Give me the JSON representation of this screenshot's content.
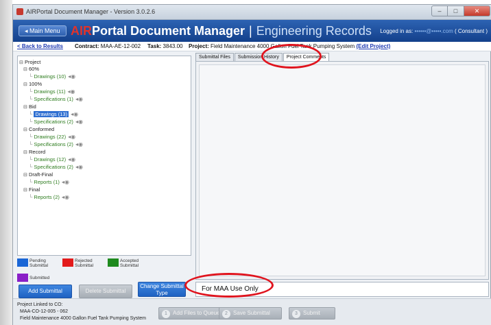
{
  "window": {
    "title": "AIRPortal Document Manager - Version 3.0.2.6",
    "minimize": "–",
    "maximize": "□",
    "close": "✕"
  },
  "header": {
    "main_menu": "◂ Main Menu",
    "brand_air": "AIR",
    "brand_rest": "Portal Document Manager",
    "brand_divider": "|",
    "brand_sub": "Engineering Records",
    "logged_in_label": "Logged in as:",
    "logged_in_user": "••••••@•••••.com",
    "logged_in_role": "( Consultant )"
  },
  "infobar": {
    "back": "< Back to Results",
    "contract_label": "Contract:",
    "contract_value": "MAA-AE-12-002",
    "task_label": "Task:",
    "task_value": "3843.00",
    "project_label": "Project:",
    "project_value": "Field Maintenance 4000 Gallon Fuel Tank Pumping System",
    "edit": "(Edit Project)"
  },
  "tree": {
    "root": "Project",
    "nodes": [
      {
        "label": "60%",
        "type": "phase"
      },
      {
        "label": "Drawings (10)",
        "type": "leaf"
      },
      {
        "label": "100%",
        "type": "phase"
      },
      {
        "label": "Drawings (11)",
        "type": "leaf"
      },
      {
        "label": "Specifications (1)",
        "type": "leaf"
      },
      {
        "label": "Bid",
        "type": "phase"
      },
      {
        "label": "Drawings (13)",
        "type": "leaf",
        "selected": true
      },
      {
        "label": "Specifications (2)",
        "type": "leaf"
      },
      {
        "label": "Conformed",
        "type": "phase"
      },
      {
        "label": "Drawings (22)",
        "type": "leaf"
      },
      {
        "label": "Specifications (2)",
        "type": "leaf"
      },
      {
        "label": "Record",
        "type": "phase"
      },
      {
        "label": "Drawings (12)",
        "type": "leaf"
      },
      {
        "label": "Specifications (2)",
        "type": "leaf"
      },
      {
        "label": "Draft-Final",
        "type": "phase"
      },
      {
        "label": "Reports (1)",
        "type": "leaf"
      },
      {
        "label": "Final",
        "type": "phase"
      },
      {
        "label": "Reports (2)",
        "type": "leaf"
      }
    ]
  },
  "legend": [
    {
      "label": "Pending Submittal",
      "color": "#1a66d6"
    },
    {
      "label": "Rejected Submittal",
      "color": "#e31b1b"
    },
    {
      "label": "Accepted Submittal",
      "color": "#1e8a1e"
    },
    {
      "label": "Submitted",
      "color": "#8a1fc7"
    }
  ],
  "buttons": {
    "add_submittal": "Add Submittal",
    "delete_submittal": "Delete Submittal",
    "change_submittal_type": "Change Submittal Type"
  },
  "tabs": [
    {
      "label": "Submittal Files",
      "active": false
    },
    {
      "label": "Submission History",
      "active": false
    },
    {
      "label": "Project Comments",
      "active": true
    }
  ],
  "comment_input": {
    "value": "For MAA Use Only"
  },
  "bottom": {
    "linked_label": "Project Linked to CO:",
    "linked_co": "MAA-CO-12-005 - 062",
    "linked_project": "Field Maintenance 4000 Gallon Fuel Tank Pumping System",
    "steps": [
      {
        "num": "1",
        "label": "Add Files to Queue"
      },
      {
        "num": "2",
        "label": "Save Submittal"
      },
      {
        "num": "3",
        "label": "Submit"
      }
    ]
  },
  "colors": {
    "header_blue": "#1d4f9e",
    "annotation_red": "#e0141e",
    "selected_blue": "#2f6fd1"
  }
}
